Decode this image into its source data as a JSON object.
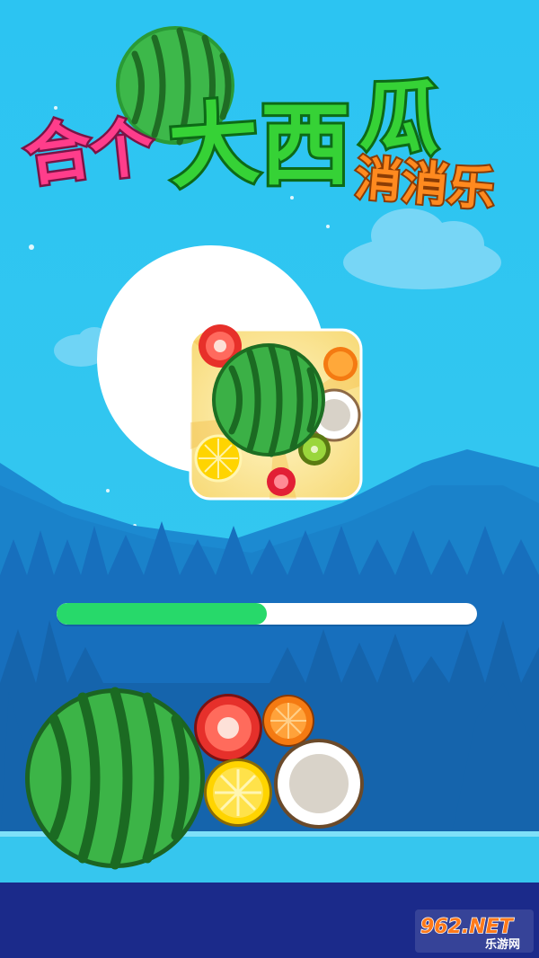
{
  "title": {
    "main_chars": [
      "合",
      "个",
      "大",
      "西",
      "瓜"
    ],
    "subtitle": "消消乐"
  },
  "loading": {
    "progress": 0.5,
    "fill_color": "#27d96a",
    "track_color": "#ffffff"
  },
  "icons": {
    "app_icon": "fruit-merge-app-icon",
    "fruits": [
      "watermelon-icon",
      "tomato-icon",
      "orange-icon",
      "lemon-icon",
      "coconut-icon",
      "kiwi-icon",
      "strawberry-icon"
    ]
  },
  "watermark": {
    "logo_text": "962.NET",
    "caption": "乐游网"
  },
  "colors": {
    "sky": "#2ec3f0",
    "mountains": "#1a86cc",
    "forest": "#1367b0",
    "ground": "#1b2a8a",
    "water": "#35c8ef"
  }
}
